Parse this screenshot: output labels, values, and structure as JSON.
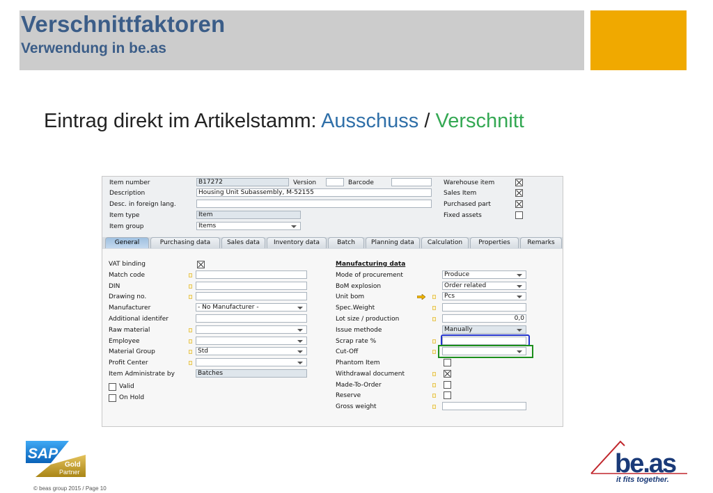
{
  "slide": {
    "title": "Verschnittfaktoren",
    "subtitle": "Verwendung in be.as",
    "headline_prefix": "Eintrag direkt im Artikelstamm: ",
    "headline_ausschuss": "Ausschuss",
    "headline_sep": " / ",
    "headline_verschnitt": "Verschnitt",
    "footer": "© beas group 2015 / Page 10",
    "colors": {
      "title": "#3b5d88",
      "accent": "#f0a900",
      "ausschuss": "#2f6fa8",
      "verschnitt": "#34a853"
    }
  },
  "logos": {
    "sap_text": "SAP",
    "sap_gold": "Gold",
    "sap_partner": "Partner",
    "beas_text": "be.as",
    "beas_tagline": "it fits together."
  },
  "header": {
    "item_number_label": "Item number",
    "item_number": "B17272",
    "version_label": "Version",
    "version": "",
    "barcode_label": "Barcode",
    "barcode": "",
    "description_label": "Description",
    "description": "Housing Unit Subassembly, M-52155",
    "desc_foreign_label": "Desc. in foreign lang.",
    "desc_foreign": "",
    "item_type_label": "Item type",
    "item_type": "Item",
    "item_group_label": "Item group",
    "item_group": "Items",
    "warehouse_item_label": "Warehouse item",
    "sales_item_label": "Sales Item",
    "purchased_part_label": "Purchased part",
    "fixed_assets_label": "Fixed assets"
  },
  "tabs": [
    {
      "label": "General"
    },
    {
      "label": "Purchasing data"
    },
    {
      "label": "Sales data"
    },
    {
      "label": "Inventory data"
    },
    {
      "label": "Batch"
    },
    {
      "label": "Planning data"
    },
    {
      "label": "Calculation"
    },
    {
      "label": "Properties"
    },
    {
      "label": "Remarks"
    }
  ],
  "general": {
    "vat_binding": "VAT binding",
    "match_code": "Match code",
    "din": "DIN",
    "drawing_no": "Drawing no.",
    "manufacturer": "Manufacturer",
    "manufacturer_value": "- No Manufacturer -",
    "additional_identifier": "Additional identifer",
    "raw_material": "Raw material",
    "employee": "Employee",
    "material_group": "Material Group",
    "material_group_value": "Std",
    "profit_center": "Profit Center",
    "item_administrate_by": "Item Administrate by",
    "item_administrate_value": "Batches",
    "valid": "Valid",
    "on_hold": "On Hold"
  },
  "manufacturing": {
    "section_title": "Manufacturing data",
    "mode_of_procurement": "Mode of procurement",
    "mode_of_procurement_value": "Produce",
    "bom_explosion": "BoM explosion",
    "bom_explosion_value": "Order related",
    "unit_bom": "Unit bom",
    "unit_bom_value": "Pcs",
    "spec_weight": "Spec.Weight",
    "lot_size": "Lot size / production",
    "lot_size_value": "0,0",
    "issue_method": "Issue methode",
    "issue_method_value": "Manually",
    "scrap_rate": "Scrap rate %",
    "cut_off": "Cut-Off",
    "phantom_item": "Phantom Item",
    "withdrawal_document": "Withdrawal document",
    "made_to_order": "Made-To-Order",
    "reserve": "Reserve",
    "gross_weight": "Gross weight"
  }
}
